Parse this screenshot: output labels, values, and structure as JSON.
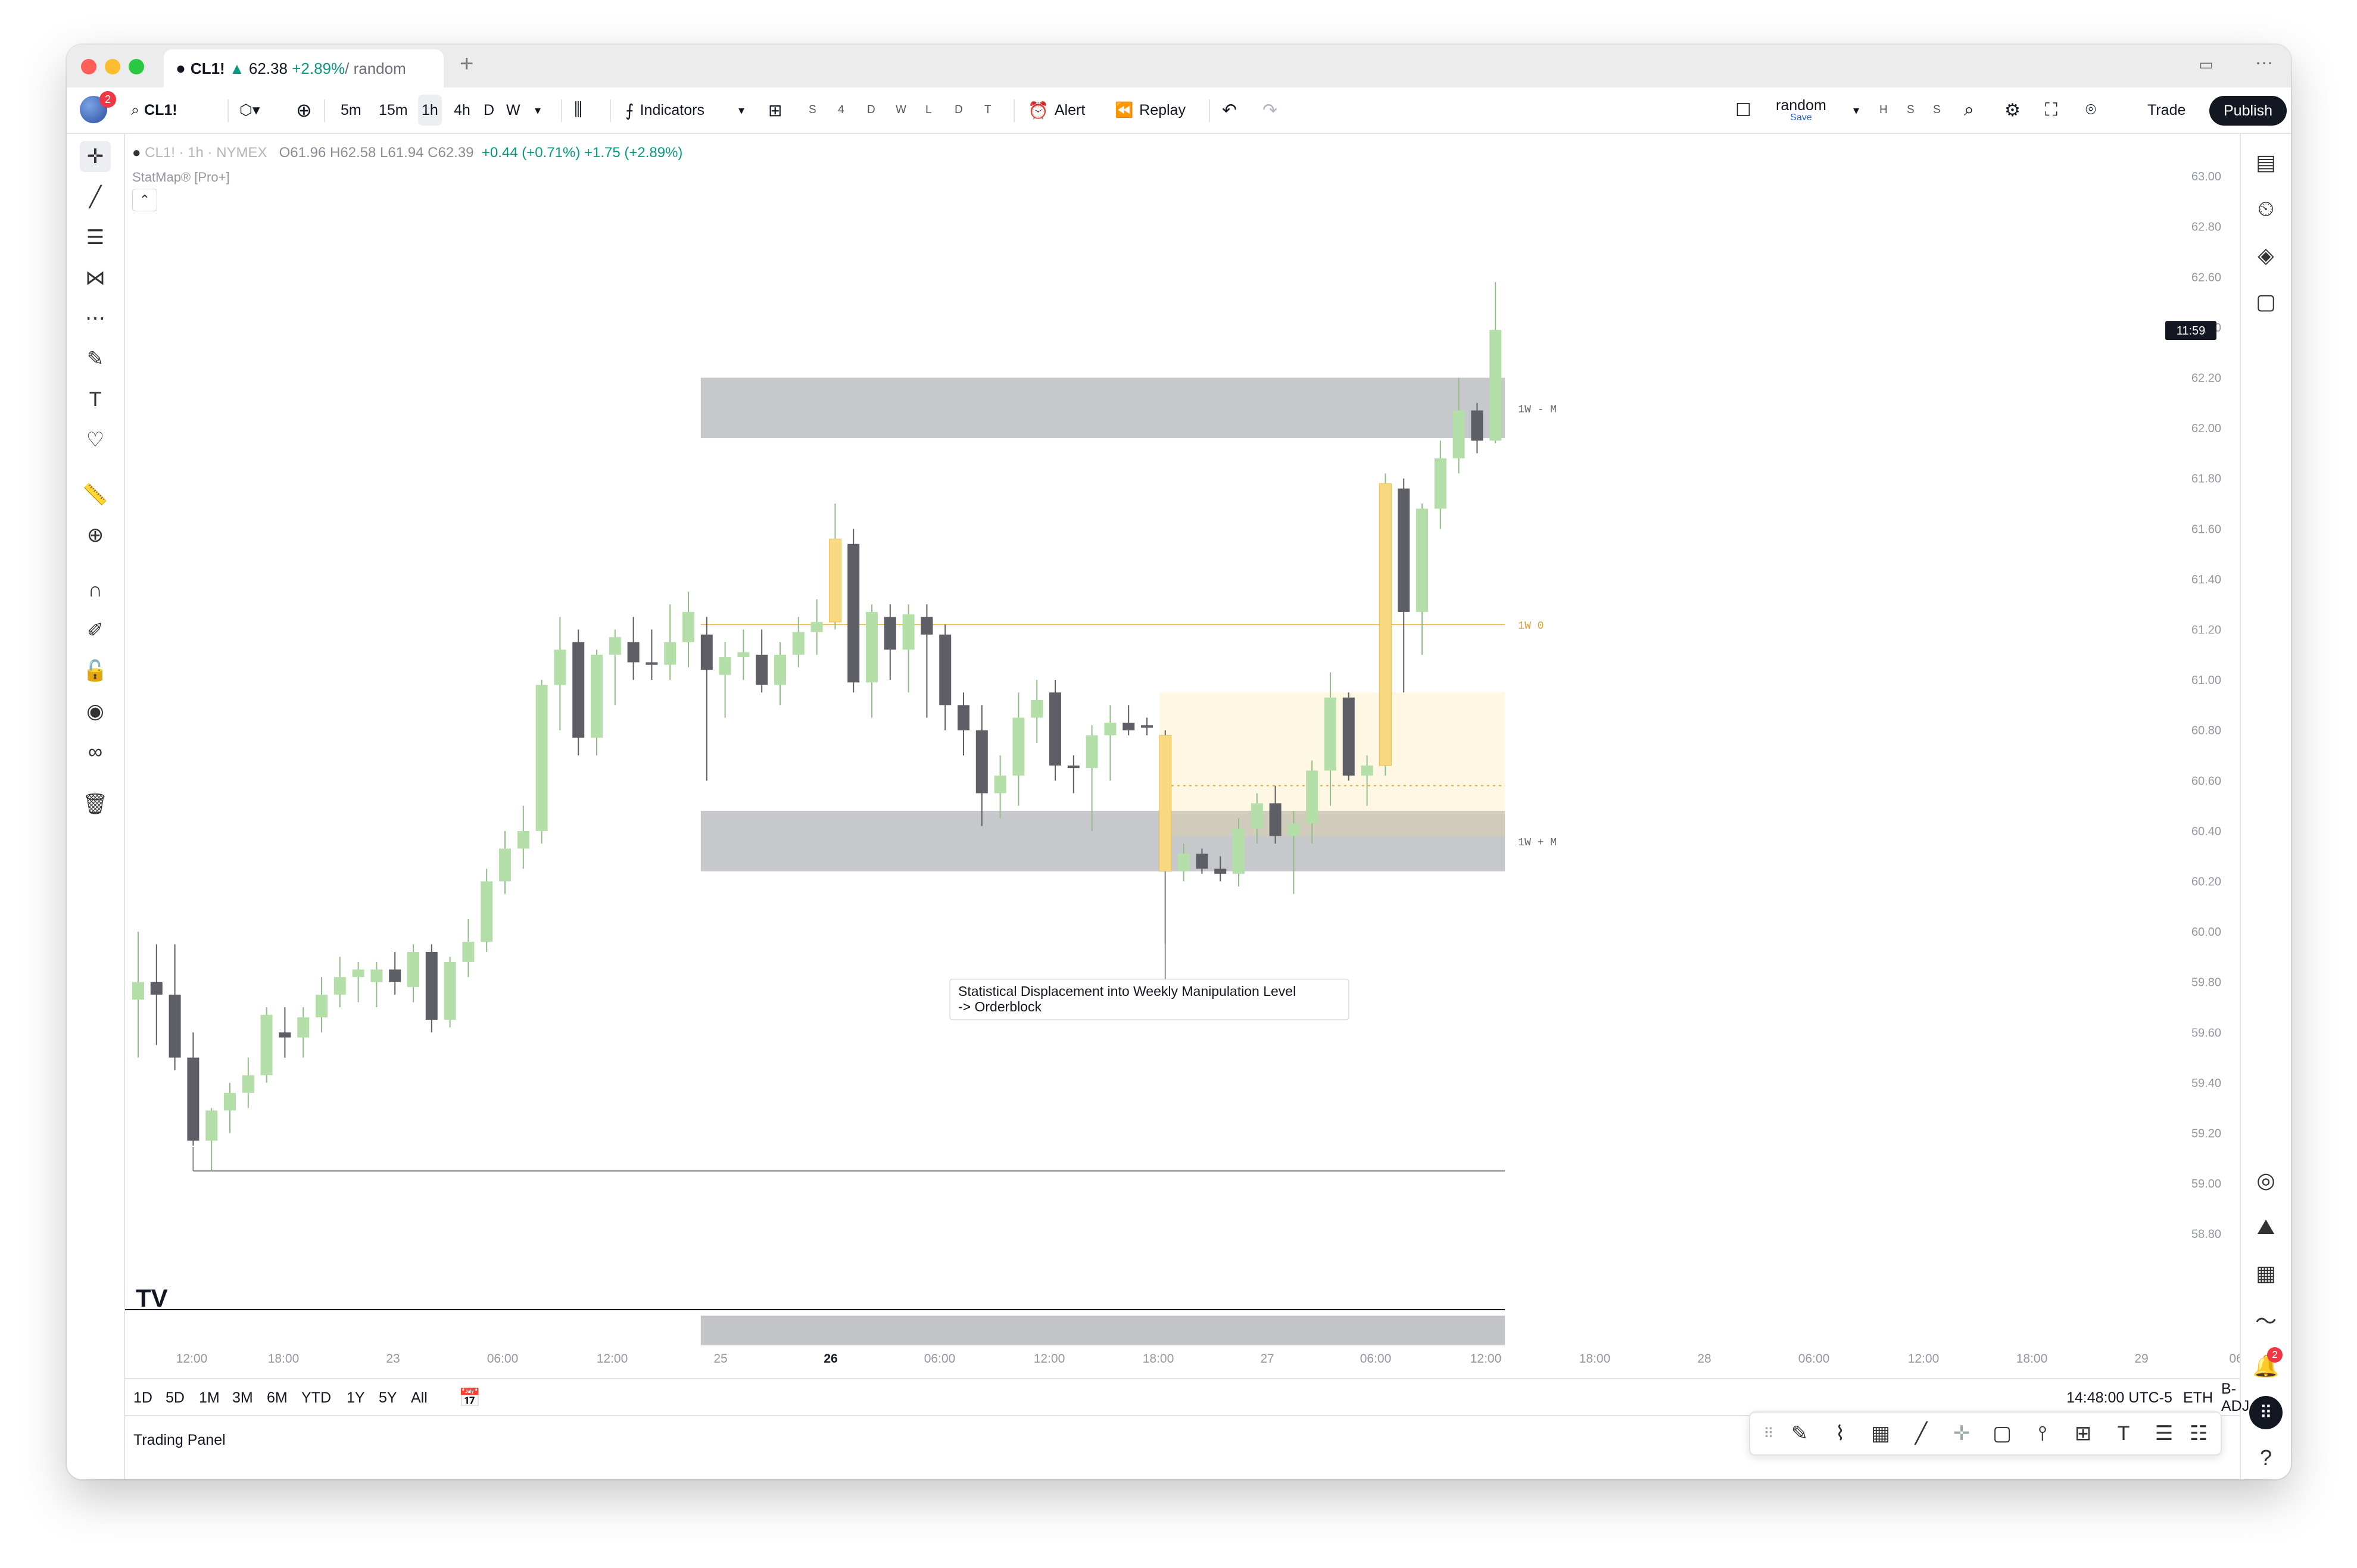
{
  "tab": {
    "symbol": "CL1!",
    "arrow": "▲",
    "price": "62.38",
    "change": "+2.89%",
    "suffix": " / random"
  },
  "toolbar": {
    "symbol": "CL1!",
    "avatar_badge": "2",
    "intervals": [
      "5m",
      "15m",
      "1h",
      "4h",
      "D",
      "W"
    ],
    "active_interval": "1h",
    "indicators_label": "Indicators",
    "quick_intervals": [
      "S",
      "4",
      "D",
      "W",
      "L",
      "D",
      "T"
    ],
    "alert_label": "Alert",
    "replay_label": "Replay",
    "layout_name": "random",
    "layout_save": "Save",
    "hss": [
      "H",
      "S",
      "S"
    ],
    "trade_label": "Trade",
    "publish_label": "Publish"
  },
  "legend": {
    "symbol": "CL1! · 1h · NYMEX",
    "ohlc": "O61.96 H62.58 L61.94 C62.39",
    "change": "+0.44 (+0.71%) +1.75 (+2.89%)",
    "indicator": "StatMap® [Pro+]"
  },
  "chart_data": {
    "type": "candlestick",
    "symbol": "CL1!",
    "interval": "1h",
    "exchange": "NYMEX",
    "ylim": [
      58.7,
      63.05
    ],
    "y_ticks": [
      "63.00",
      "62.80",
      "62.60",
      "62.40",
      "62.20",
      "62.00",
      "61.80",
      "61.60",
      "61.40",
      "61.20",
      "61.00",
      "60.80",
      "60.60",
      "60.40",
      "60.20",
      "60.00",
      "59.80",
      "59.60",
      "59.40",
      "59.20",
      "59.00",
      "58.80"
    ],
    "x_ticks": [
      "12:00",
      "18:00",
      "23",
      "06:00",
      "12:00",
      "25",
      "26",
      "06:00",
      "12:00",
      "18:00",
      "27",
      "06:00",
      "12:00",
      "18:00",
      "28",
      "06:00",
      "12:00",
      "18:00",
      "29",
      "06"
    ],
    "price_label": "11:59",
    "candles": [
      {
        "o": 59.73,
        "h": 60.0,
        "l": 59.5,
        "c": 59.8
      },
      {
        "o": 59.8,
        "h": 59.95,
        "l": 59.55,
        "c": 59.75
      },
      {
        "o": 59.75,
        "h": 59.95,
        "l": 59.45,
        "c": 59.5
      },
      {
        "o": 59.5,
        "h": 59.6,
        "l": 59.15,
        "c": 59.17
      },
      {
        "o": 59.17,
        "h": 59.3,
        "l": 59.05,
        "c": 59.29
      },
      {
        "o": 59.29,
        "h": 59.4,
        "l": 59.2,
        "c": 59.36
      },
      {
        "o": 59.36,
        "h": 59.5,
        "l": 59.3,
        "c": 59.43
      },
      {
        "o": 59.43,
        "h": 59.7,
        "l": 59.4,
        "c": 59.67
      },
      {
        "o": 59.6,
        "h": 59.7,
        "l": 59.5,
        "c": 59.58
      },
      {
        "o": 59.58,
        "h": 59.7,
        "l": 59.5,
        "c": 59.66
      },
      {
        "o": 59.66,
        "h": 59.82,
        "l": 59.6,
        "c": 59.75
      },
      {
        "o": 59.75,
        "h": 59.9,
        "l": 59.7,
        "c": 59.82
      },
      {
        "o": 59.82,
        "h": 59.88,
        "l": 59.72,
        "c": 59.85
      },
      {
        "o": 59.8,
        "h": 59.88,
        "l": 59.7,
        "c": 59.85
      },
      {
        "o": 59.85,
        "h": 59.92,
        "l": 59.75,
        "c": 59.8
      },
      {
        "o": 59.78,
        "h": 59.95,
        "l": 59.72,
        "c": 59.92
      },
      {
        "o": 59.92,
        "h": 59.95,
        "l": 59.6,
        "c": 59.65
      },
      {
        "o": 59.65,
        "h": 59.9,
        "l": 59.62,
        "c": 59.88
      },
      {
        "o": 59.88,
        "h": 60.05,
        "l": 59.82,
        "c": 59.96
      },
      {
        "o": 59.96,
        "h": 60.25,
        "l": 59.92,
        "c": 60.2
      },
      {
        "o": 60.2,
        "h": 60.4,
        "l": 60.15,
        "c": 60.33
      },
      {
        "o": 60.33,
        "h": 60.5,
        "l": 60.25,
        "c": 60.4
      },
      {
        "o": 60.4,
        "h": 61.0,
        "l": 60.35,
        "c": 60.98
      },
      {
        "o": 60.98,
        "h": 61.25,
        "l": 60.8,
        "c": 61.12
      },
      {
        "o": 61.15,
        "h": 61.2,
        "l": 60.7,
        "c": 60.77
      },
      {
        "o": 60.77,
        "h": 61.12,
        "l": 60.7,
        "c": 61.1
      },
      {
        "o": 61.1,
        "h": 61.2,
        "l": 60.9,
        "c": 61.17
      },
      {
        "o": 61.15,
        "h": 61.25,
        "l": 61.0,
        "c": 61.07
      },
      {
        "o": 61.07,
        "h": 61.2,
        "l": 61.0,
        "c": 61.06
      },
      {
        "o": 61.06,
        "h": 61.3,
        "l": 61.0,
        "c": 61.15
      },
      {
        "o": 61.15,
        "h": 61.35,
        "l": 61.05,
        "c": 61.27
      },
      {
        "o": 61.18,
        "h": 61.25,
        "l": 60.6,
        "c": 61.04
      },
      {
        "o": 61.02,
        "h": 61.15,
        "l": 60.85,
        "c": 61.09
      },
      {
        "o": 61.09,
        "h": 61.2,
        "l": 61.0,
        "c": 61.11
      },
      {
        "o": 61.1,
        "h": 61.2,
        "l": 60.95,
        "c": 60.98
      },
      {
        "o": 60.98,
        "h": 61.15,
        "l": 60.9,
        "c": 61.1
      },
      {
        "o": 61.1,
        "h": 61.25,
        "l": 61.05,
        "c": 61.19
      },
      {
        "o": 61.19,
        "h": 61.32,
        "l": 61.1,
        "c": 61.23
      },
      {
        "o": 61.23,
        "h": 61.7,
        "l": 61.2,
        "c": 61.56
      },
      {
        "o": 61.54,
        "h": 61.6,
        "l": 60.95,
        "c": 60.99
      },
      {
        "o": 60.99,
        "h": 61.3,
        "l": 60.85,
        "c": 61.27
      },
      {
        "o": 61.25,
        "h": 61.3,
        "l": 61.0,
        "c": 61.12
      },
      {
        "o": 61.12,
        "h": 61.3,
        "l": 60.95,
        "c": 61.26
      },
      {
        "o": 61.25,
        "h": 61.3,
        "l": 60.85,
        "c": 61.18
      },
      {
        "o": 61.18,
        "h": 61.22,
        "l": 60.8,
        "c": 60.9
      },
      {
        "o": 60.9,
        "h": 60.95,
        "l": 60.7,
        "c": 60.8
      },
      {
        "o": 60.8,
        "h": 60.9,
        "l": 60.42,
        "c": 60.55
      },
      {
        "o": 60.55,
        "h": 60.7,
        "l": 60.45,
        "c": 60.62
      },
      {
        "o": 60.62,
        "h": 60.95,
        "l": 60.5,
        "c": 60.85
      },
      {
        "o": 60.85,
        "h": 61.0,
        "l": 60.75,
        "c": 60.92
      },
      {
        "o": 60.95,
        "h": 61.0,
        "l": 60.6,
        "c": 60.66
      },
      {
        "o": 60.66,
        "h": 60.7,
        "l": 60.55,
        "c": 60.65
      },
      {
        "o": 60.65,
        "h": 60.82,
        "l": 60.4,
        "c": 60.78
      },
      {
        "o": 60.78,
        "h": 60.9,
        "l": 60.6,
        "c": 60.83
      },
      {
        "o": 60.83,
        "h": 60.9,
        "l": 60.78,
        "c": 60.8
      },
      {
        "o": 60.82,
        "h": 60.85,
        "l": 60.78,
        "c": 60.81
      },
      {
        "o": 60.78,
        "h": 60.8,
        "l": 59.95,
        "c": 60.24
      },
      {
        "o": 60.24,
        "h": 60.35,
        "l": 60.2,
        "c": 60.31
      },
      {
        "o": 60.31,
        "h": 60.33,
        "l": 60.23,
        "c": 60.25
      },
      {
        "o": 60.25,
        "h": 60.3,
        "l": 60.2,
        "c": 60.23
      },
      {
        "o": 60.23,
        "h": 60.45,
        "l": 60.18,
        "c": 60.41
      },
      {
        "o": 60.41,
        "h": 60.55,
        "l": 60.35,
        "c": 60.51
      },
      {
        "o": 60.51,
        "h": 60.58,
        "l": 60.35,
        "c": 60.38
      },
      {
        "o": 60.38,
        "h": 60.48,
        "l": 60.15,
        "c": 60.43
      },
      {
        "o": 60.43,
        "h": 60.68,
        "l": 60.35,
        "c": 60.64
      },
      {
        "o": 60.64,
        "h": 61.03,
        "l": 60.5,
        "c": 60.93
      },
      {
        "o": 60.93,
        "h": 60.95,
        "l": 60.6,
        "c": 60.62
      },
      {
        "o": 60.62,
        "h": 60.7,
        "l": 60.5,
        "c": 60.66
      },
      {
        "o": 60.66,
        "h": 61.82,
        "l": 60.62,
        "c": 61.78
      },
      {
        "o": 61.76,
        "h": 61.8,
        "l": 60.95,
        "c": 61.27
      },
      {
        "o": 61.27,
        "h": 61.7,
        "l": 61.1,
        "c": 61.68
      },
      {
        "o": 61.68,
        "h": 61.95,
        "l": 61.6,
        "c": 61.88
      },
      {
        "o": 61.88,
        "h": 62.2,
        "l": 61.82,
        "c": 62.07
      },
      {
        "o": 62.07,
        "h": 62.1,
        "l": 61.9,
        "c": 61.95
      },
      {
        "o": 61.95,
        "h": 62.58,
        "l": 61.94,
        "c": 62.39
      }
    ],
    "zones": [
      {
        "label": "1W - M",
        "top": 62.2,
        "bottom": 61.96
      },
      {
        "label": "1W + M",
        "top": 60.48,
        "bottom": 60.24
      }
    ],
    "levels": [
      {
        "label": "1W 0",
        "value": 61.22
      },
      {
        "label": "",
        "value": 59.05
      }
    ],
    "annotation": {
      "line1": "Statistical Displacement into Weekly Manipulation Level",
      "line2": "-> Orderblock"
    }
  },
  "ranges": [
    "1D",
    "5D",
    "1M",
    "3M",
    "6M",
    "YTD",
    "1Y",
    "5Y",
    "All"
  ],
  "footer": {
    "time": "14:48:00 UTC-5",
    "eth": "ETH",
    "adj": "B-ADJ",
    "trading_panel": "Trading Panel",
    "alerts_badge": "2"
  },
  "colors": {
    "up": "#b4dfa9",
    "down": "#5d5e66",
    "zone": "#c4c5c9",
    "highlight": "#f7d981",
    "accent": "#131722",
    "badge": "#f23645"
  }
}
